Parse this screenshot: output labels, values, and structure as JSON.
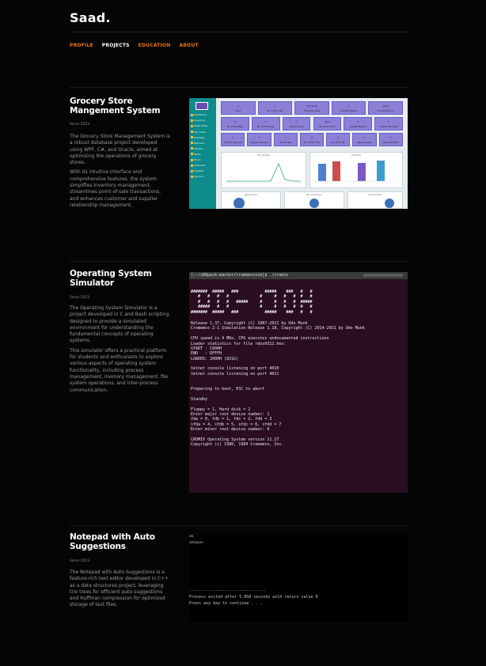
{
  "site": {
    "brand": "Saad.",
    "nav": [
      {
        "label": "PROFILE",
        "color": "#e8731a"
      },
      {
        "label": "PROJECTS",
        "color": "#ffffff"
      },
      {
        "label": "EDUCATION",
        "color": "#e8731a"
      },
      {
        "label": "ABOUT",
        "color": "#e8731a"
      }
    ]
  },
  "projects": [
    {
      "title": "Grocery Store Mangement System",
      "since": "Since 2023",
      "paragraphs": [
        "The Grocery Store Management System is a robust database project developed using WPF, C#, and Oracle, aimed at optimizing the operations of grocery stores.",
        "With its intuitive interface and comprehensive features, the system simplifies inventory management, streamlines point-of-sale transactions, and enhances customer and supplier relationship management."
      ]
    },
    {
      "title": "Operating System Simulator",
      "since": "Since 2023",
      "paragraphs": [
        "The Operating System Simulator is a project developed in C and Bash scripting, designed to provide a simulated environment for understanding the fundamental concepts of operating systems.",
        "This simulator offers a practical platform for students and enthusiasts to explore various aspects of operating system functionality, including process management, memory management, file system operations, and inter-process communication."
      ]
    },
    {
      "title": "Notepad with Auto Suggestions",
      "since": "Since 2023",
      "paragraphs": [
        "The Notepad with Auto Suggestions is a feature-rich text editor developed in C++ as a data structures project, leveraging trie trees for efficient auto-suggestions and Huffman compression for optimized storage of text files."
      ]
    }
  ],
  "terminal": {
    "prompt": "[:~/z80pack-master/cromemcosim]$ ./cromix",
    "lines": [
      "Release 1.37, Copyright (C) 1987-2021 by Udo Munk",
      "Cromemco Z-1 Simulation Release 1.18, Copyright (C) 2014-2021 by Udo Munk",
      "",
      "CPU speed is 4 MHz, CPU executes undocumented instructions",
      "Loader statistics for file rdos0312.hex:",
      "START : C000H",
      "END   : DFFFH",
      "LOADED: 2000H (8192)",
      "",
      "telnet console listening on port 4010",
      "telnet console listening on port 4011",
      "",
      "",
      "Preparing to boot, ESC to abort",
      "",
      "Standby",
      "",
      "Floppy = 1, Hard disk = 2",
      "Enter major root device number: 1",
      "fda = 0, fdb = 1, fdc = 2, fdd = 3",
      "sfda = 4, sfdb = 5, sfdc = 6, sfdd = 7",
      "Enter minor root device number: 0",
      "",
      "CROMIX Operating System version 11.27",
      "Copyright (c) 1980, 1984 Cromemco, Inc."
    ],
    "art": [
      "#######  #####   ###           #####    ###   #   #",
      "   #   #   #   #             #     #   #   #  #   #",
      "   #   #   #   #   #####     #     #   #   #  #####",
      "   #####   #   #             #     #   #   #  #   #",
      "#######  #####   ###           #####    ###   #   #"
    ]
  },
  "notepad": {
    "top_lines": [
      "ok",
      "amazon"
    ],
    "divider": "--------------------------------",
    "exit_line": "Process exited after 5.858 seconds with return value 0",
    "press_line": "Press any key to continue . . ."
  },
  "grocery_app": {
    "menu": [
      "Dashboard",
      "Inventory",
      "Sales Order",
      "Pur. Order",
      "Purchase",
      "Payment",
      "Vendors",
      "Items",
      "Stock",
      "Customer",
      "Supplier",
      "Log Out"
    ],
    "tiles": [
      [
        "0",
        "Sales"
      ],
      [
        "0",
        "No. Of Purchase"
      ],
      [
        "160 705.50",
        "Total Sales Value"
      ],
      [
        "0",
        "Customer Returns"
      ],
      [
        "139.95",
        "Purchase Returns"
      ],
      [
        "0",
        "No. Of Sale Bills"
      ],
      [
        "0",
        "No. Of Purchases"
      ],
      [
        "9",
        "Vendors Count"
      ],
      [
        "1000",
        "Bill Items Count"
      ],
      [
        "0",
        "Supplier Balance"
      ],
      [
        "0",
        "Supplier Purchase"
      ],
      [
        "6",
        "Customer Payment"
      ],
      [
        "0",
        "Supplier Payment"
      ],
      [
        "0",
        "Vendor Bills"
      ],
      [
        "25",
        "No. Of Stock Qty"
      ],
      [
        "0",
        "No. Order Qty"
      ],
      [
        "5",
        "Remaining Qty"
      ],
      [
        "0",
        "Remainder Bills"
      ]
    ],
    "panel_titles": [
      "Day Of Sales",
      "Top Items",
      "Debt Position",
      "Stock Summary",
      "Stock Position"
    ],
    "colors": {
      "sidebar": "#0e8a8a",
      "tile": "#8b7fd8",
      "bar1": "#4f7fd1",
      "bar2": "#d04b4b",
      "bar3": "#7b59c4",
      "bar4": "#3c9ccf"
    }
  }
}
